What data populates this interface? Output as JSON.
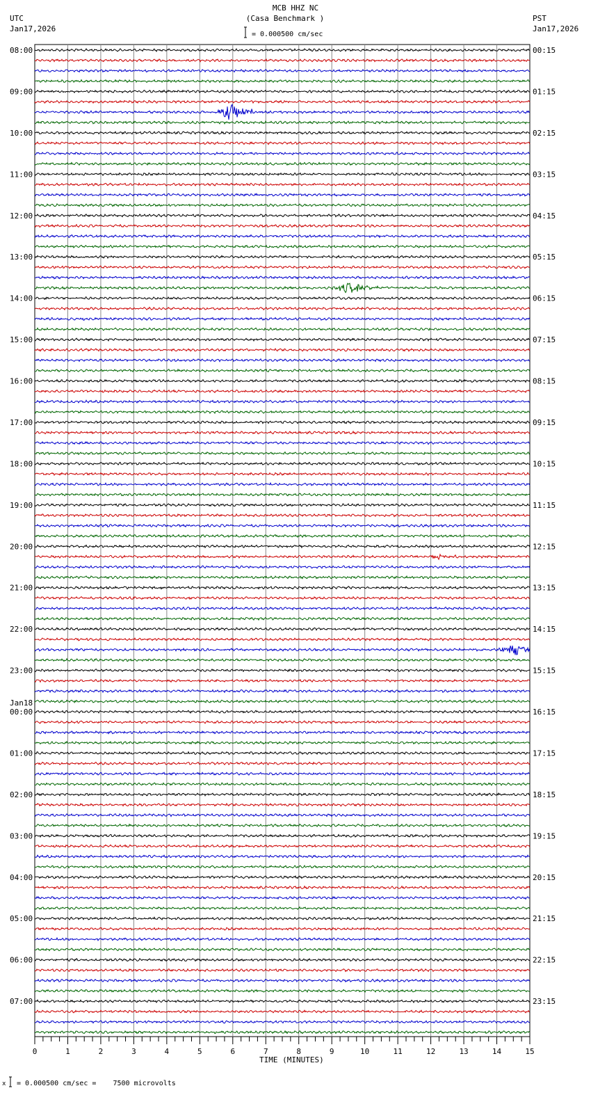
{
  "chart_data": {
    "type": "line",
    "title": "MCB HHZ NC",
    "subtitle": "(Casa Benchmark )",
    "left_timezone": "UTC",
    "left_date": "Jan17,2026",
    "right_timezone": "PST",
    "right_date": "Jan17,2026",
    "scale_label": "= 0.000500 cm/sec",
    "footer_scale_label": "= 0.000500 cm/sec =    7500 microvolts",
    "footer_prefix": "x",
    "xlabel": "TIME (MINUTES)",
    "xlim": [
      0,
      15
    ],
    "x_ticks": [
      "0",
      "1",
      "2",
      "3",
      "4",
      "5",
      "6",
      "7",
      "8",
      "9",
      "10",
      "11",
      "12",
      "13",
      "14",
      "15"
    ],
    "traces_per_hour": 4,
    "trace_colors": [
      "#000000",
      "#cc0000",
      "#0000cc",
      "#006600"
    ],
    "left_hour_labels": [
      "08:00",
      "09:00",
      "10:00",
      "11:00",
      "12:00",
      "13:00",
      "14:00",
      "15:00",
      "16:00",
      "17:00",
      "18:00",
      "19:00",
      "20:00",
      "21:00",
      "22:00",
      "23:00",
      "00:00",
      "01:00",
      "02:00",
      "03:00",
      "04:00",
      "05:00",
      "06:00",
      "07:00"
    ],
    "date_change_label": {
      "hour_index": 16,
      "text": "Jan18"
    },
    "right_hour_labels": [
      "00:15",
      "01:15",
      "02:15",
      "03:15",
      "04:15",
      "05:15",
      "06:15",
      "07:15",
      "08:15",
      "09:15",
      "10:15",
      "11:15",
      "12:15",
      "13:15",
      "14:15",
      "15:15",
      "16:15",
      "17:15",
      "18:15",
      "19:15",
      "20:15",
      "21:15",
      "22:15",
      "23:15"
    ],
    "events": [
      {
        "trace": 6,
        "start_min": 5.5,
        "peak_min": 6.0,
        "end_min": 6.6,
        "amplitude": 2.2
      },
      {
        "trace": 23,
        "start_min": 9.0,
        "peak_min": 9.6,
        "end_min": 10.4,
        "amplitude": 1.4
      },
      {
        "trace": 49,
        "start_min": 11.9,
        "peak_min": 12.2,
        "end_min": 12.9,
        "amplitude": 0.5
      },
      {
        "trace": 58,
        "start_min": 14.0,
        "peak_min": 14.5,
        "end_min": 15.0,
        "amplitude": 1.6
      }
    ]
  }
}
